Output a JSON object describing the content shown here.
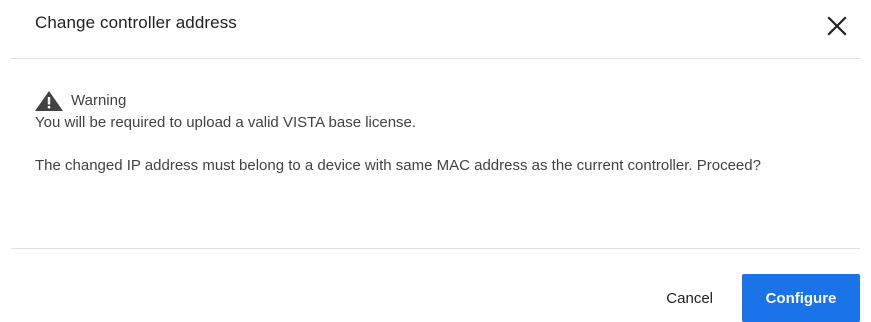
{
  "dialog": {
    "title": "Change controller address",
    "close_icon": "close-icon",
    "warning": {
      "icon": "warning-icon",
      "label": "Warning"
    },
    "message_line1": "You will be required to upload a valid VISTA base license.",
    "message_line2": "The changed IP address must belong to a device with same MAC address as the current controller. Proceed?",
    "actions": {
      "cancel_label": "Cancel",
      "configure_label": "Configure"
    }
  },
  "colors": {
    "primary": "#1a73e8",
    "text": "#212121",
    "divider": "#e0e0e0"
  }
}
